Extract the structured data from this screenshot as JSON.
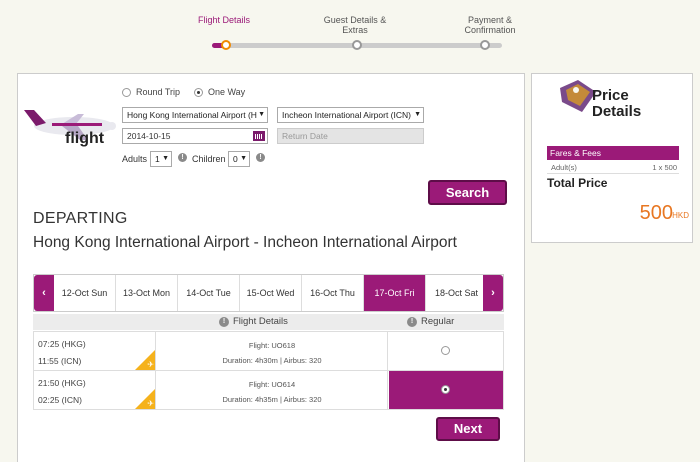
{
  "steps": [
    {
      "label": "Flight Details"
    },
    {
      "label": "Guest Details & Extras"
    },
    {
      "label": "Payment & Confirmation"
    }
  ],
  "brand": {
    "word": "flight"
  },
  "trip_type": {
    "round_trip": "Round Trip",
    "one_way": "One Way",
    "selected": "one_way"
  },
  "search": {
    "origin": "Hong Kong International Airport (H",
    "destination": "Incheon International Airport (ICN)",
    "depart_date": "2014-10-15",
    "return_placeholder": "Return Date",
    "adults_label": "Adults",
    "adults_value": "1",
    "children_label": "Children",
    "children_value": "0",
    "button": "Search"
  },
  "departing": {
    "title": "DEPARTING",
    "route": "Hong Kong International Airport - Incheon International Airport"
  },
  "date_tabs": [
    "12-Oct Sun",
    "13-Oct Mon",
    "14-Oct Tue",
    "15-Oct Wed",
    "16-Oct Thu",
    "17-Oct Fri",
    "18-Oct Sat"
  ],
  "selected_date_index": 5,
  "table": {
    "col_details": "Flight Details",
    "col_fare": "Regular",
    "rows": [
      {
        "dep": "07:25 (HKG)",
        "arr": "11:55 (ICN)",
        "flight": "Flight: UO618",
        "duration": "Duration: 4h30m | Airbus: 320",
        "selected": false
      },
      {
        "dep": "21:50 (HKG)",
        "arr": "02:25 (ICN)",
        "flight": "Flight: UO614",
        "duration": "Duration: 4h35m | Airbus: 320",
        "selected": true
      }
    ]
  },
  "next_button": "Next",
  "price": {
    "title_line1": "Price",
    "title_line2": "Details",
    "fares_label": "Fares & Fees",
    "adult_label": "Adult(s)",
    "adult_value": "1 x 500",
    "total_label": "Total Price",
    "total_value": "500",
    "currency": "HKD"
  },
  "colors": {
    "accent": "#9b1a78",
    "orange": "#e87722",
    "yellow": "#f5b21c"
  }
}
